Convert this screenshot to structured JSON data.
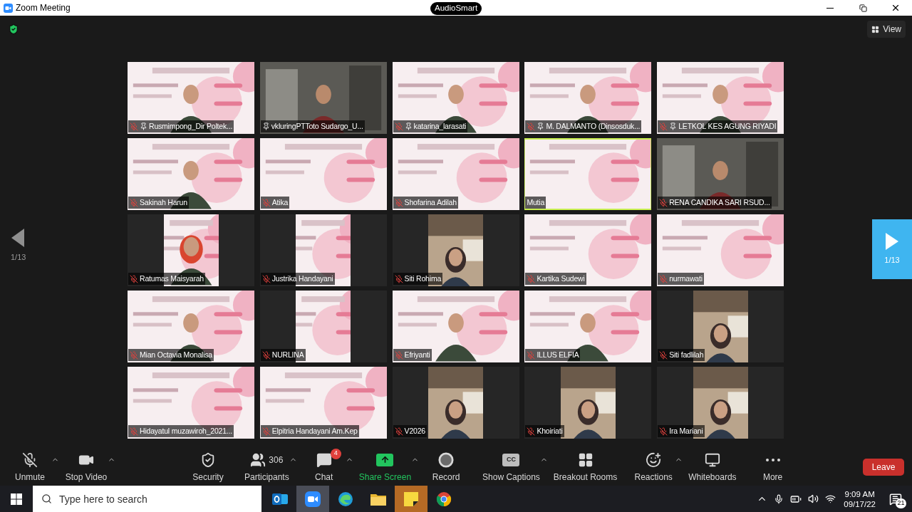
{
  "window": {
    "title": "Zoom Meeting",
    "badge": "AudioSmart"
  },
  "top_bar": {
    "view_button": "View"
  },
  "pager": {
    "left": "1/13",
    "right": "1/13"
  },
  "tiles": [
    {
      "name": "Rusmimpong_Dir Poltek...",
      "muted": true,
      "pinned": true,
      "speaking": false,
      "kind": "presenter"
    },
    {
      "name": "vkluringPTToto Sudargo_U...",
      "muted": false,
      "pinned": true,
      "speaking": false,
      "kind": "room"
    },
    {
      "name": "katarina_larasati",
      "muted": true,
      "pinned": true,
      "speaking": false,
      "kind": "presenter"
    },
    {
      "name": "M. DALMANTO (Dinsosduk...",
      "muted": true,
      "pinned": true,
      "speaking": false,
      "kind": "presenter"
    },
    {
      "name": "LETKOL KES AGUNG RIYADI",
      "muted": true,
      "pinned": true,
      "speaking": false,
      "kind": "presenter"
    },
    {
      "name": "Sakinah Harun",
      "muted": true,
      "pinned": false,
      "speaking": false,
      "kind": "presenter"
    },
    {
      "name": "Atika",
      "muted": true,
      "pinned": false,
      "speaking": false,
      "kind": "slide"
    },
    {
      "name": "Shofarina Adilah",
      "muted": true,
      "pinned": false,
      "speaking": false,
      "kind": "slide"
    },
    {
      "name": "Mutia",
      "muted": false,
      "pinned": false,
      "speaking": true,
      "kind": "slide"
    },
    {
      "name": "RENA CANDIKA SARI RSUD...",
      "muted": true,
      "pinned": false,
      "speaking": false,
      "kind": "room"
    },
    {
      "name": "Ratumas Maisyarah",
      "muted": true,
      "pinned": false,
      "speaking": false,
      "kind": "narrow-presenter"
    },
    {
      "name": "Justrika Handayani",
      "muted": true,
      "pinned": false,
      "speaking": false,
      "kind": "narrow-slide"
    },
    {
      "name": "Siti Rohima",
      "muted": true,
      "pinned": false,
      "speaking": false,
      "kind": "narrow-webcam"
    },
    {
      "name": "Kartika Sudewi",
      "muted": true,
      "pinned": false,
      "speaking": false,
      "kind": "slide"
    },
    {
      "name": "nurmawati",
      "muted": true,
      "pinned": false,
      "speaking": false,
      "kind": "slide"
    },
    {
      "name": "Mian Octavia Monalisa",
      "muted": true,
      "pinned": false,
      "speaking": false,
      "kind": "presenter"
    },
    {
      "name": "NURLINA",
      "muted": true,
      "pinned": false,
      "speaking": false,
      "kind": "narrow-slide"
    },
    {
      "name": "Efriyanti",
      "muted": true,
      "pinned": false,
      "speaking": false,
      "kind": "presenter"
    },
    {
      "name": "ILLUS ELFIA",
      "muted": true,
      "pinned": false,
      "speaking": false,
      "kind": "presenter"
    },
    {
      "name": "Siti fadlilah",
      "muted": true,
      "pinned": false,
      "speaking": false,
      "kind": "narrow-webcam"
    },
    {
      "name": "Hidayatul muzawiroh_2021...",
      "muted": true,
      "pinned": false,
      "speaking": false,
      "kind": "slide"
    },
    {
      "name": "Elpitria Handayani Am.Kep",
      "muted": true,
      "pinned": false,
      "speaking": false,
      "kind": "slide"
    },
    {
      "name": "V2026",
      "muted": true,
      "pinned": false,
      "speaking": false,
      "kind": "narrow-webcam"
    },
    {
      "name": "Khoiriati",
      "muted": true,
      "pinned": false,
      "speaking": false,
      "kind": "narrow-webcam"
    },
    {
      "name": "Ira Mariani",
      "muted": true,
      "pinned": false,
      "speaking": false,
      "kind": "narrow-webcam"
    }
  ],
  "toolbar": [
    {
      "kind": "unmute",
      "label": "Unmute",
      "caret": true
    },
    {
      "kind": "video",
      "label": "Stop Video",
      "caret": true
    },
    {
      "kind": "security",
      "label": "Security",
      "caret": false
    },
    {
      "kind": "participants",
      "label": "Participants",
      "count": "306",
      "caret": true
    },
    {
      "kind": "chat",
      "label": "Chat",
      "badge": "4",
      "caret": true
    },
    {
      "kind": "share",
      "label": "Share Screen",
      "caret": true
    },
    {
      "kind": "record",
      "label": "Record",
      "caret": false
    },
    {
      "kind": "captions",
      "label": "Show Captions",
      "icon_text": "CC",
      "caret": true
    },
    {
      "kind": "breakout",
      "label": "Breakout Rooms",
      "caret": false
    },
    {
      "kind": "reactions",
      "label": "Reactions",
      "caret": true
    },
    {
      "kind": "whiteboards",
      "label": "Whiteboards",
      "caret": false
    },
    {
      "kind": "more",
      "label": "More",
      "caret": false
    }
  ],
  "leave_button": "Leave",
  "taskbar": {
    "search": {
      "placeholder": "Type here to search"
    },
    "apps": [
      {
        "kind": "mail",
        "active": false
      },
      {
        "kind": "zoom",
        "active": true
      },
      {
        "kind": "edge",
        "active": false
      },
      {
        "kind": "files",
        "active": false
      },
      {
        "kind": "notes",
        "active": true
      },
      {
        "kind": "chrome",
        "active": false
      }
    ],
    "time": "9:09 AM",
    "date": "09/17/22",
    "notifications": "21"
  }
}
